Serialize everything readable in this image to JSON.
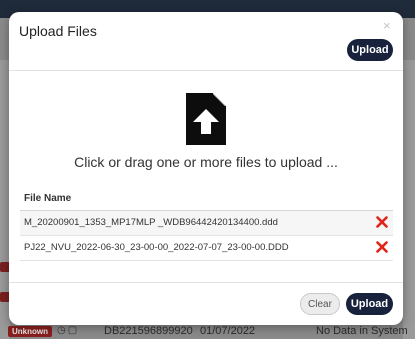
{
  "background": {
    "unknown_badge": "Unknown",
    "card_number": "DB22159689992​0",
    "date": "01/07/2022",
    "status": "No Data in System"
  },
  "modal": {
    "title": "Upload Files",
    "close_symbol": "×",
    "upload_button_top": "Upload",
    "drop_text": "Click or drag one or more files to upload ...",
    "column_header": "File Name",
    "files": [
      {
        "name": "M_20200901_1353_MP17MLP _WDB96442420134400.ddd"
      },
      {
        "name": "PJ22_NVU_2022-06-30_23-00-00_2022-07-07_23-00-00.DDD"
      }
    ],
    "clear_button": "Clear",
    "upload_button_bottom": "Upload"
  },
  "colors": {
    "primary": "#18223d",
    "remove": "#e0241b"
  },
  "icons": {
    "upload": "file-upload-icon",
    "remove": "remove-file-icon"
  }
}
